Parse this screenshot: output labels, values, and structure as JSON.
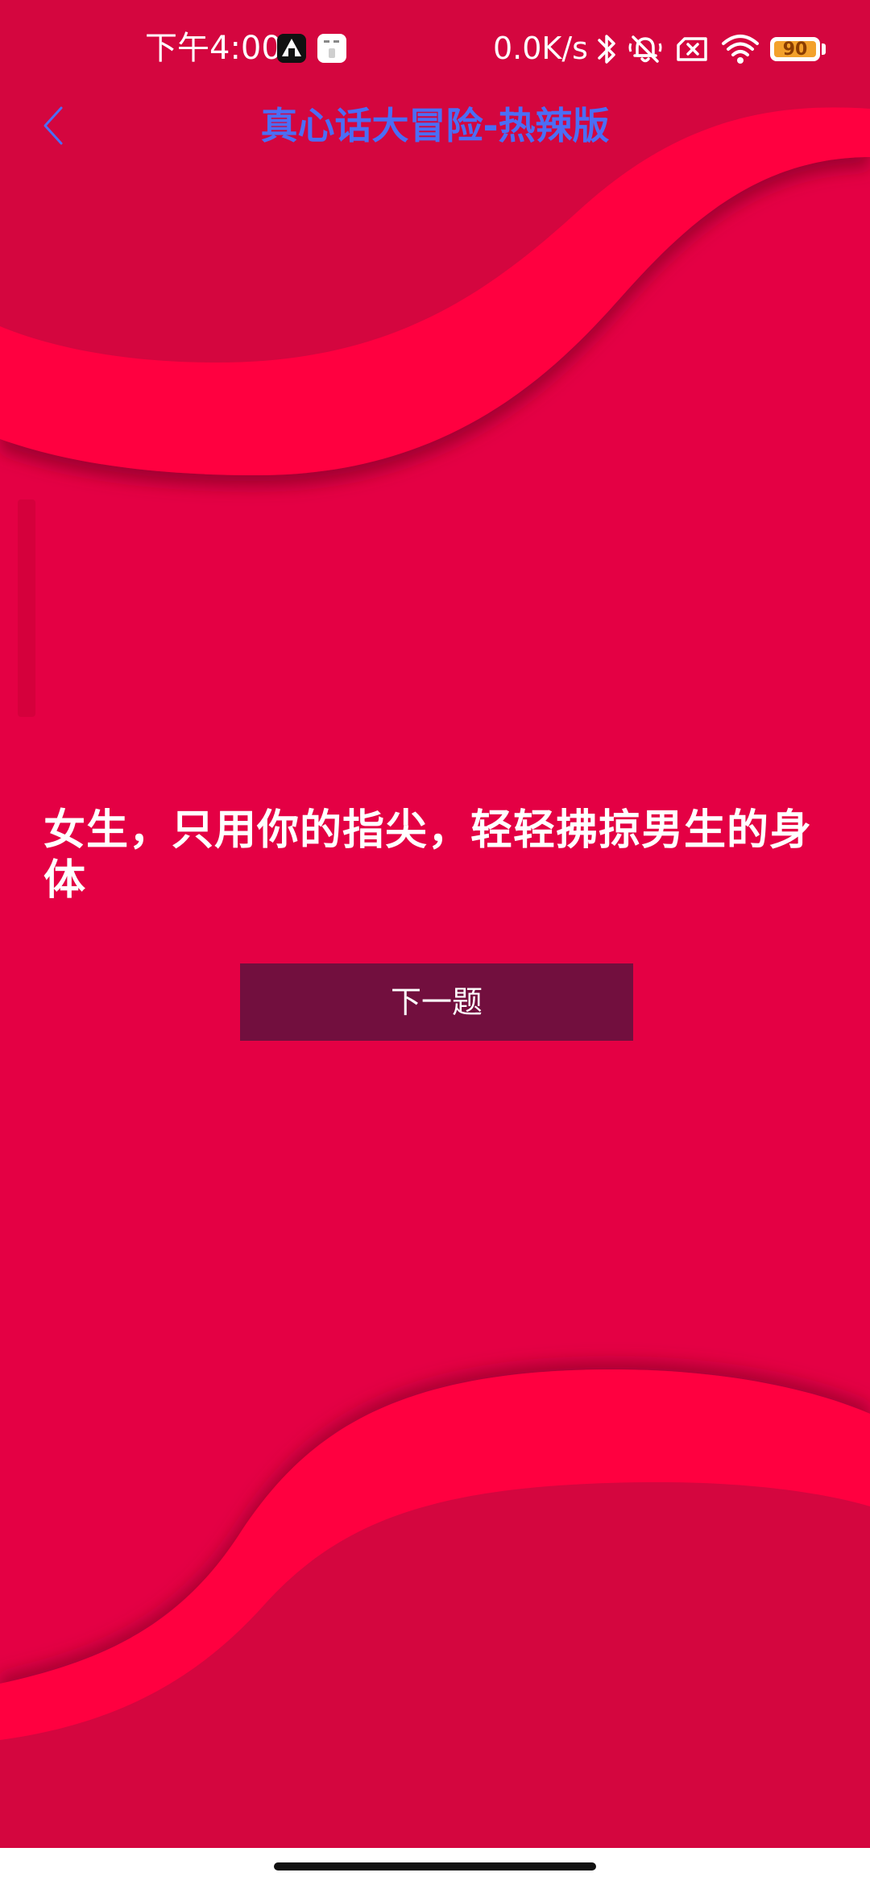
{
  "status_bar": {
    "time": "下午4:00",
    "net_speed": "0.0K/s",
    "battery_level": "90",
    "icons": [
      "bluetooth-icon",
      "mute-bell-icon",
      "no-sim-icon",
      "wifi-icon",
      "battery-icon"
    ]
  },
  "header": {
    "back_icon": "chevron-left-icon",
    "title": "真心话大冒险-热辣版"
  },
  "content": {
    "question": "女生，只用你的指尖，轻轻拂掠男生的身体",
    "next_button_label": "下一题"
  },
  "colors": {
    "background": "#E40044",
    "wave_light": "#FF0040",
    "wave_dark": "#D4063F",
    "title": "#4B6EF5",
    "button": "#720F3E"
  }
}
